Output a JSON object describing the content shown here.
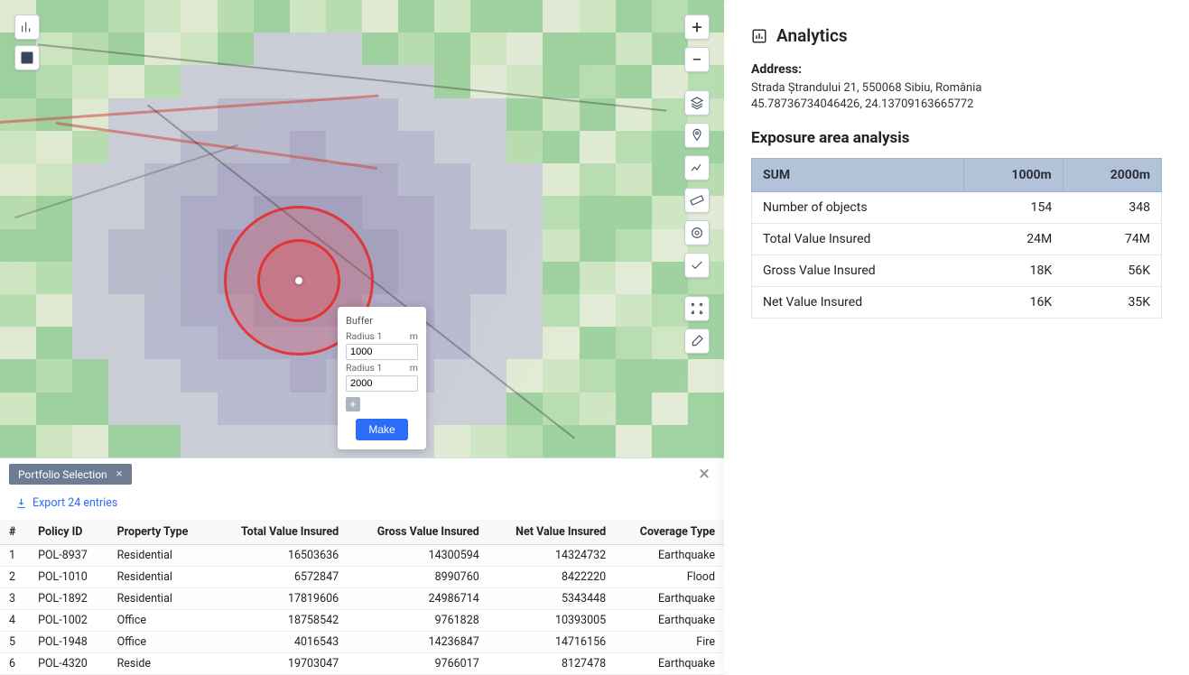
{
  "analytics": {
    "title": "Analytics",
    "address_label": "Address:",
    "address_line": "Strada Ștrandului 21, 550068 Sibiu, România",
    "coords": "45.78736734046426, 24.13709163665772",
    "exposure_title": "Exposure area analysis",
    "table": {
      "head": [
        "SUM",
        "1000m",
        "2000m"
      ],
      "rows": [
        {
          "label": "Number of objects",
          "v1": "154",
          "v2": "348"
        },
        {
          "label": "Total Value Insured",
          "v1": "24M",
          "v2": "74M"
        },
        {
          "label": "Gross Value Insured",
          "v1": "18K",
          "v2": "56K"
        },
        {
          "label": "Net Value Insured",
          "v1": "16K",
          "v2": "35K"
        }
      ]
    }
  },
  "buffer": {
    "title": "Buffer",
    "radius1_label": "Radius 1",
    "unit": "m",
    "radius1_value": "1000",
    "radius2_label": "Radius 1",
    "radius2_value": "2000",
    "make_label": "Make"
  },
  "portfolio": {
    "tab_label": "Portfolio Selection",
    "export_label": "Export 24 entries",
    "columns": [
      "#",
      "Policy ID",
      "Property Type",
      "Total Value Insured",
      "Gross Value Insured",
      "Net Value Insured",
      "Coverage Type"
    ],
    "rows": [
      {
        "n": "1",
        "id": "POL-8937",
        "ptype": "Residential",
        "tvi": "16503636",
        "gvi": "14300594",
        "nvi": "14324732",
        "cov": "Earthquake"
      },
      {
        "n": "2",
        "id": "POL-1010",
        "ptype": "Residential",
        "tvi": "6572847",
        "gvi": "8990760",
        "nvi": "8422220",
        "cov": "Flood"
      },
      {
        "n": "3",
        "id": "POL-1892",
        "ptype": "Residential",
        "tvi": "17819606",
        "gvi": "24986714",
        "nvi": "5343448",
        "cov": "Earthquake"
      },
      {
        "n": "4",
        "id": "POL-1002",
        "ptype": "Office",
        "tvi": "18758542",
        "gvi": "9761828",
        "nvi": "10393005",
        "cov": "Earthquake"
      },
      {
        "n": "5",
        "id": "POL-1948",
        "ptype": "Office",
        "tvi": "4016543",
        "gvi": "14236847",
        "nvi": "14716156",
        "cov": "Fire"
      },
      {
        "n": "6",
        "id": "POL-4320",
        "ptype": "Reside",
        "tvi": "19703047",
        "gvi": "9766017",
        "nvi": "8127478",
        "cov": "Earthquake"
      }
    ]
  },
  "map_tools": {
    "chart_icon": "chart",
    "table_icon": "table",
    "zoom_in": "+",
    "zoom_out": "−"
  }
}
